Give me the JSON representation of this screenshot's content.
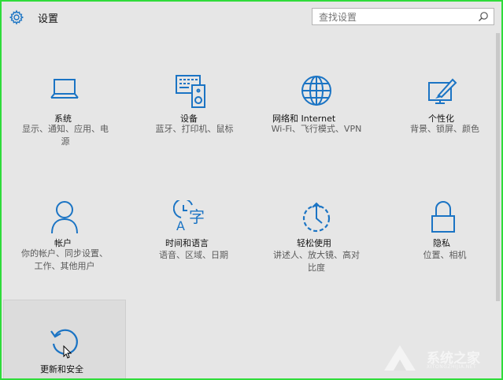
{
  "header": {
    "title": "设置",
    "search_placeholder": "查找设置"
  },
  "tiles": [
    {
      "name": "系统",
      "desc_line1": "显示、通知、应用、电",
      "desc_line2": "源",
      "icon": "laptop-icon"
    },
    {
      "name": "设备",
      "desc_line1": "蓝牙、打印机、鼠标",
      "icon": "devices-icon"
    },
    {
      "name": "网络和 Internet",
      "desc_line1": "Wi-Fi、飞行模式、VPN",
      "icon": "globe-icon"
    },
    {
      "name": "个性化",
      "desc_line1": "背景、锁屏、颜色",
      "icon": "personalization-icon"
    },
    {
      "name": "帐户",
      "desc_line1": "你的帐户、同步设置、",
      "desc_line2": "工作、其他用户",
      "icon": "person-icon"
    },
    {
      "name": "时间和语言",
      "desc_line1": "语音、区域、日期",
      "icon": "time-language-icon"
    },
    {
      "name": "轻松使用",
      "desc_line1": "讲述人、放大镜、高对",
      "desc_line2": "比度",
      "icon": "ease-of-access-icon"
    },
    {
      "name": "隐私",
      "desc_line1": "位置、相机",
      "icon": "lock-icon"
    },
    {
      "name": "更新和安全",
      "icon": "update-icon"
    }
  ],
  "watermark": {
    "text": "系统之家",
    "sub": "XITONGZHIJIA.NET"
  },
  "colors": {
    "accent": "#1b74c4",
    "frame": "#2fdc3a"
  }
}
